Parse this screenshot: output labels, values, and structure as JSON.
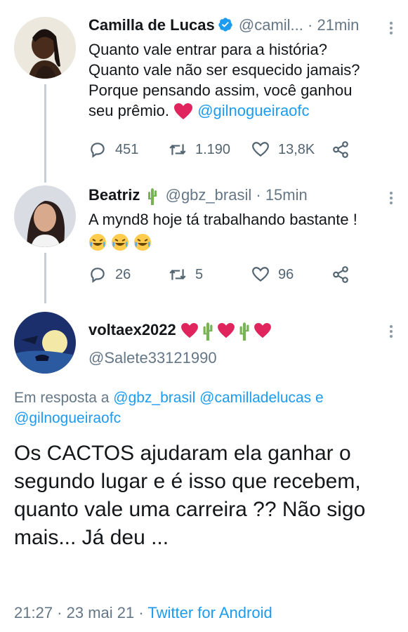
{
  "tweet1": {
    "name": "Camilla de Lucas",
    "handle": "@camil...",
    "sep": "·",
    "time": "21min",
    "line1": "Quanto vale entrar para a história?",
    "line2": "Quanto vale não ser esquecido jamais?",
    "line3": "Porque pensando assim, você ganhou",
    "line4_text": "seu prêmio.",
    "line4_mention": "@gilnogueiraofc",
    "replies": "451",
    "retweets": "1.190",
    "likes": "13,8K"
  },
  "tweet2": {
    "name": "Beatriz",
    "handle": "@gbz_brasil",
    "sep": "·",
    "time": "15min",
    "line1": "A mynd8 hoje tá trabalhando bastante !",
    "replies": "26",
    "retweets": "5",
    "likes": "96"
  },
  "tweet3": {
    "name": "voltaex2022",
    "handle": "@Salete33121990",
    "reply_prefix": "Em resposta a",
    "reply_mentions": "@gbz_brasil @camilladelucas e",
    "reply_mentions2": "@gilnogueiraofc",
    "text": "Os CACTOS  ajudaram ela ganhar o segundo lugar  e  é isso que recebem,  quanto vale uma carreira ?? Não sigo mais... Já deu ...",
    "date": "21:27 · 23 mai 21 ·",
    "source": "Twitter for Android"
  },
  "colors": {
    "accent": "#1d9bf0",
    "muted": "#657786",
    "heart": "#e0245e"
  }
}
